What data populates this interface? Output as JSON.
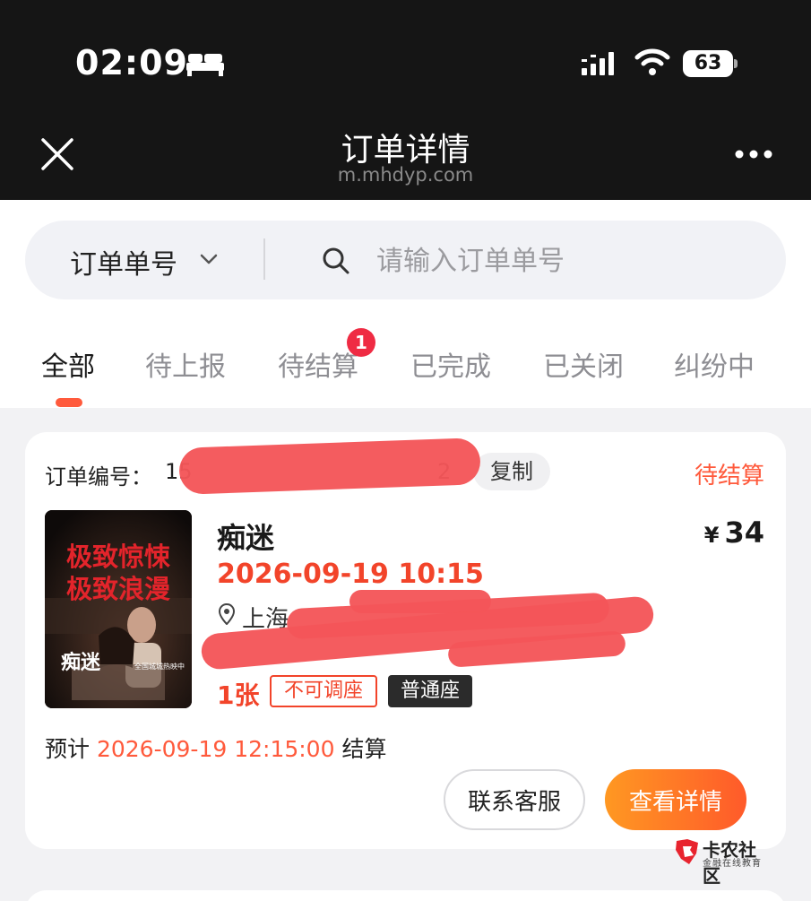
{
  "status_bar": {
    "time": "02:09",
    "battery": "63"
  },
  "nav": {
    "title": "订单详情",
    "url": "m.mhdyp.com"
  },
  "search": {
    "type_label": "订单单号",
    "placeholder": "请输入订单单号"
  },
  "tabs": [
    {
      "label": "全部",
      "active": true
    },
    {
      "label": "待上报",
      "active": false
    },
    {
      "label": "待结算",
      "active": false,
      "badge": "1"
    },
    {
      "label": "已完成",
      "active": false
    },
    {
      "label": "已关闭",
      "active": false
    },
    {
      "label": "纠纷中",
      "active": false
    }
  ],
  "order": {
    "number_label": "订单编号：",
    "number_visible_head": "15",
    "number_visible_tail": "2",
    "copy_label": "复制",
    "status": "待结算",
    "movie_title": "痴迷",
    "price_symbol": "¥",
    "price": "34",
    "showtime": "2026-09-19 10:15",
    "cinema_prefix": "上海",
    "quantity": "1张",
    "tag_seat_adjust": "不可调座",
    "tag_seat_type": "普通座",
    "settle_prefix": "预计",
    "settle_time": "2026-09-19 12:15:00",
    "settle_suffix": "结算",
    "btn_service": "联系客服",
    "btn_detail": "查看详情",
    "poster": {
      "headline_line1": "极致惊悚",
      "headline_line2": "极致浪漫",
      "title": "痴迷",
      "subtitle": "全国城城热映中"
    }
  },
  "watermark": {
    "name": "卡农社区",
    "sub": "金融在线教育"
  },
  "colors": {
    "accent": "#ff5a3c",
    "price_red": "#f2442a",
    "badge": "#ef2b43",
    "header_bg": "#151515"
  }
}
